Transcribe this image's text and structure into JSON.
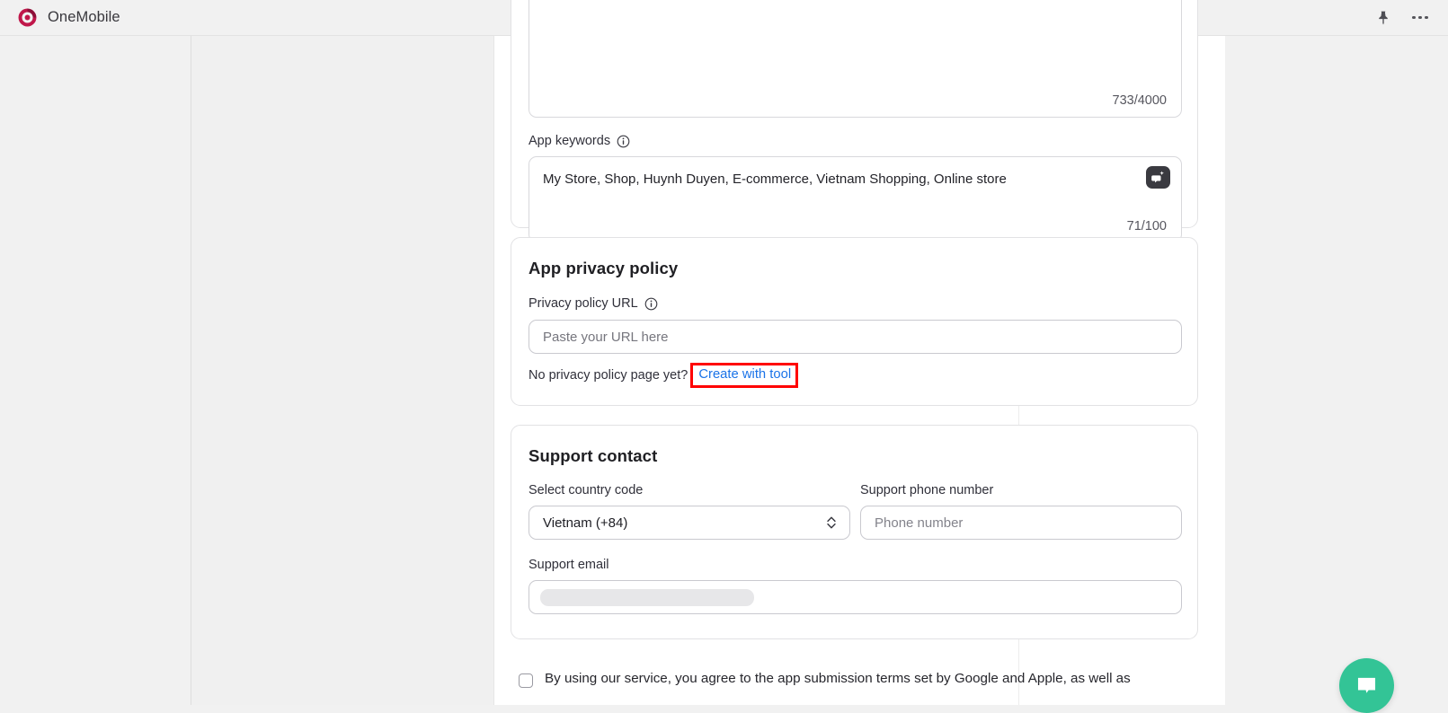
{
  "topbar": {
    "brand_name": "OneMobile",
    "logo_color": "#c0174a",
    "pin_icon": "pin-icon",
    "more_icon": "more-horizontal-icon"
  },
  "keywords_card": {
    "description_counter": "733/4000",
    "keywords_label": "App keywords",
    "keywords_info_icon": "info-icon",
    "keywords_value": "My Store, Shop, Huynh Duyen, E-commerce, Vietnam Shopping, Online store",
    "keywords_counter": "71/100",
    "ai_button_icon": "ai-magic-icon"
  },
  "privacy_card": {
    "title": "App privacy policy",
    "url_label": "Privacy policy URL",
    "url_info_icon": "info-icon",
    "url_placeholder": "Paste your URL here",
    "url_value": "",
    "hint_text": "No privacy policy page yet?",
    "link_label": "Create with tool",
    "link_color": "#1a73e8",
    "highlight_color": "#ff0000"
  },
  "support_card": {
    "title": "Support contact",
    "country_code_label": "Select country code",
    "country_code_value": "Vietnam (+84)",
    "country_code_icon": "chevron-up-down-icon",
    "phone_label": "Support phone number",
    "phone_placeholder": "Phone number",
    "phone_value": "",
    "email_label": "Support email",
    "email_value": "",
    "email_state": "loading-skeleton"
  },
  "terms": {
    "text": "By using our service, you agree to the app submission terms set by Google and Apple, as well as",
    "checkbox_checked": "false"
  },
  "chat": {
    "icon": "chat-bubble-icon",
    "color": "#33c496"
  }
}
